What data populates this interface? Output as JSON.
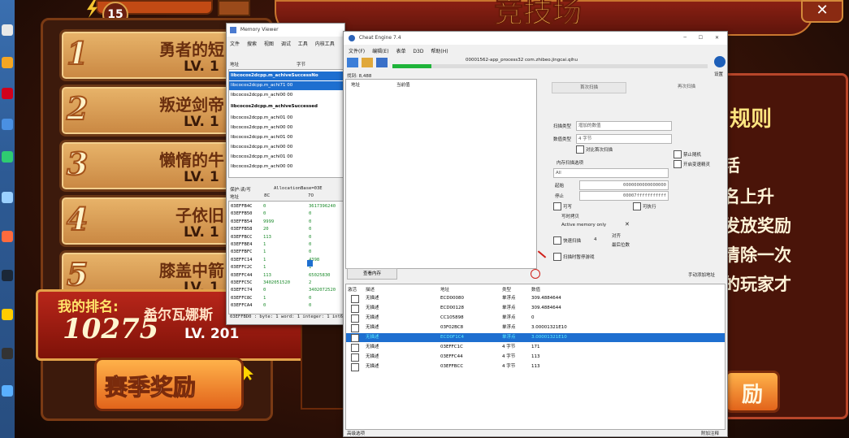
{
  "game": {
    "title_fragment": "竞技场",
    "level_badge": "15",
    "rankings": [
      {
        "rank": "1",
        "name": "勇者的短",
        "lv": "LV. 1"
      },
      {
        "rank": "2",
        "name": "叛逆剑帝",
        "lv": "LV. 1"
      },
      {
        "rank": "3",
        "name": "懒惰的牛",
        "lv": "LV. 1"
      },
      {
        "rank": "4",
        "name": "子依旧",
        "lv": "LV. 1"
      },
      {
        "rank": "5",
        "name": "膝盖中箭",
        "lv": "LV. 1"
      }
    ],
    "my_rank_label": "我的排名:",
    "my_rank_value": "10275",
    "my_name": "希尔瓦娜斯",
    "my_lv": "LV. 201",
    "season_reward_button": "赛季奖励",
    "rules_title": "规则",
    "rules_lines": [
      "活",
      "名上升",
      "发放奖励",
      "清除一次",
      "的玩家才"
    ],
    "right_button_fragment": "励"
  },
  "memory_viewer": {
    "title": "Memory Viewer",
    "menu": [
      "文件",
      "搜索",
      "视图",
      "调试",
      "工具",
      "内核工具"
    ],
    "col_address": "地址",
    "col_bytes": "字节",
    "symbol_rows": [
      {
        "text": "libcocos2dcpp.m_achiveSuccessNo",
        "style": "header-selected"
      },
      {
        "text": "libcocos2dcpp.m_achi71 00",
        "style": "selected"
      },
      {
        "text": "libcocos2dcpp.m_achi00 00",
        "style": "normal"
      },
      {
        "text": "libcocos2dcpp.m_achiveSuccessed",
        "style": "header"
      },
      {
        "text": "libcocos2dcpp.m_achi01 00",
        "style": "normal"
      },
      {
        "text": "libcocos2dcpp.m_achi00 00",
        "style": "normal"
      },
      {
        "text": "libcocos2dcpp.m_achi01 00",
        "style": "normal"
      },
      {
        "text": "libcocos2dcpp.m_achi00 00",
        "style": "normal"
      },
      {
        "text": "libcocos2dcpp.m_achi01 00",
        "style": "normal"
      },
      {
        "text": "libcocos2dcpp.m_achi00 00",
        "style": "normal"
      }
    ],
    "protect_label": "保护:读/写",
    "alloc_label": "AllocationBase=03E",
    "hex_header": {
      "addr": "地址",
      "c1": "8C",
      "c2": "70"
    },
    "hex_rows": [
      {
        "addr": "03EFFB4C",
        "v1": "0",
        "v2": "3617396240"
      },
      {
        "addr": "03EFFB50",
        "v1": "0",
        "v2": "0"
      },
      {
        "addr": "03EFFB54",
        "v1": "9999",
        "v2": "0"
      },
      {
        "addr": "03EFFB58",
        "v1": "20",
        "v2": "0"
      },
      {
        "addr": "03EFFBCC",
        "v1": "113",
        "v2": "0"
      },
      {
        "addr": "03EFFBE4",
        "v1": "1",
        "v2": "0"
      },
      {
        "addr": "03EFFBFC",
        "v1": "1",
        "v2": "0"
      },
      {
        "addr": "03EFFC14",
        "v1": "1",
        "v2": "4398"
      },
      {
        "addr": "03EFFC2C",
        "v1": "1",
        "v2": "1"
      },
      {
        "addr": "03EFFC44",
        "v1": "113",
        "v2": "65025830"
      },
      {
        "addr": "03EFFC5C",
        "v1": "3402051520",
        "v2": "2"
      },
      {
        "addr": "03EFFC74",
        "v1": "0",
        "v2": "3402072520"
      },
      {
        "addr": "03EFFC8C",
        "v1": "1",
        "v2": "0"
      },
      {
        "addr": "03EFFCA4",
        "v1": "0",
        "v2": "0"
      }
    ],
    "status": "03EFFBD0 : byte: 1 word: 1 integer: 1 int6"
  },
  "cheat_engine": {
    "title": "Cheat Engine 7.4",
    "menu": [
      "文件(F)",
      "编辑(E)",
      "表单",
      "D3D",
      "帮助(H)"
    ],
    "process": "00001562-app_process32 com.zhibeo.jingcai.qihu",
    "found_label": "找到: 8,488",
    "settings_label": "设置",
    "results_cols": {
      "address": "地址",
      "current": "当前值"
    },
    "first_scan": "首次扫描",
    "next_scan": "再次扫描",
    "scan_type_label": "扫描类型",
    "scan_type_value": "增加的数值",
    "value_type_label": "数值类型",
    "value_type_value": "4 字节",
    "compare_first": "对比首次扫描",
    "mem_options": "内存扫描选项",
    "mem_region": "All",
    "start_label": "起始",
    "start_value": "0000000000000000",
    "stop_label": "停止",
    "stop_value": "00007fffffffffff",
    "writable": "可写",
    "executable": "可执行",
    "copy_on_write": "写时拷贝",
    "active_memory": "Active memory only",
    "fast_scan": "快速扫描",
    "fast_scan_value": "4",
    "align": "对齐",
    "last_digits": "最后位数",
    "pause_game": "扫描时暂停游戏",
    "unrandomizer": "禁止随机",
    "speedhack": "开启变速精灵",
    "view_memory": "查看内存",
    "add_address": "手动添加地址",
    "table_cols": {
      "active": "激活",
      "desc": "描述",
      "address": "地址",
      "type": "类型",
      "value": "数值"
    },
    "table_rows": [
      {
        "desc": "无描述",
        "address": "ECD00080",
        "type": "单浮点",
        "value": "309.4884644"
      },
      {
        "desc": "无描述",
        "address": "ECD00128",
        "type": "单浮点",
        "value": "309.4884644"
      },
      {
        "desc": "无描述",
        "address": "CC105898",
        "type": "单浮点",
        "value": "0"
      },
      {
        "desc": "无描述",
        "address": "03F02BC8",
        "type": "单浮点",
        "value": "3.00001321E10"
      },
      {
        "desc": "无描述",
        "address": "ECD0F1C4",
        "type": "单浮点",
        "value": "3.00001321E10"
      },
      {
        "desc": "无描述",
        "address": "03EFFC1C",
        "type": "4 字节",
        "value": "171"
      },
      {
        "desc": "无描述",
        "address": "03EFFC44",
        "type": "4 字节",
        "value": "113"
      },
      {
        "desc": "无描述",
        "address": "03EFFBCC",
        "type": "4 字节",
        "value": "113"
      }
    ],
    "selected_row_index": 4,
    "advanced_options": "高级选项",
    "table_extras": "附加注释"
  }
}
